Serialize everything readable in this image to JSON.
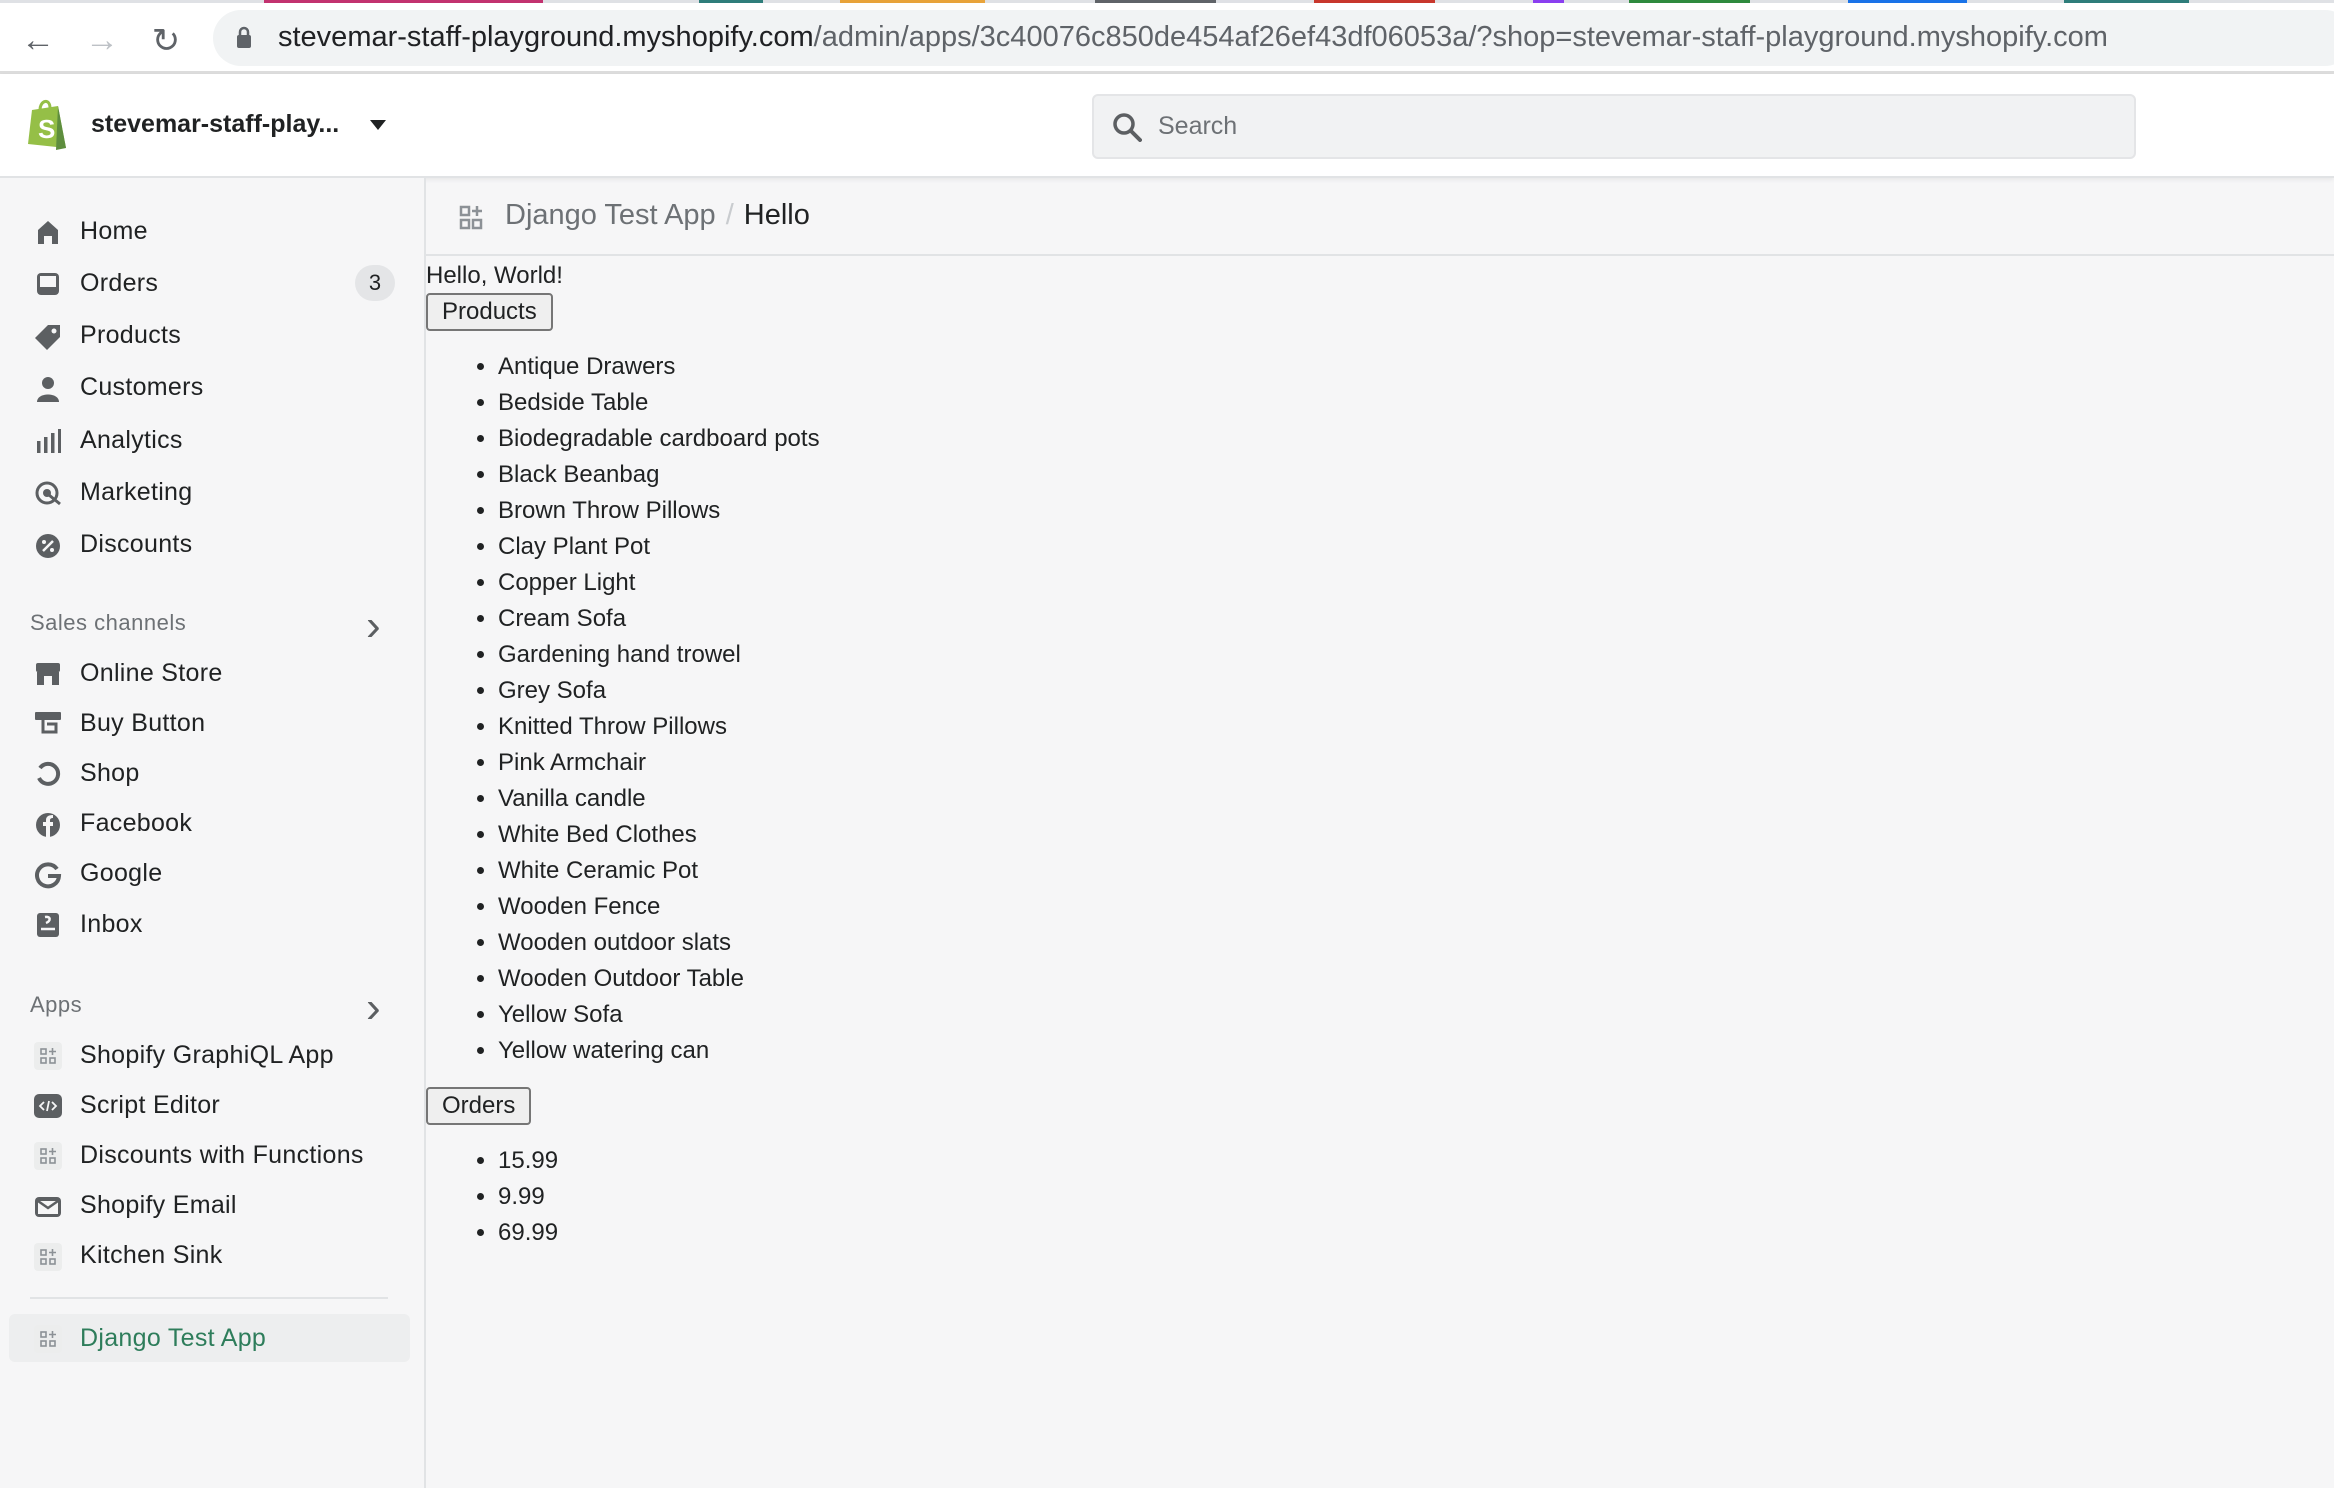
{
  "browser": {
    "url_host": "stevemar-staff-playground.myshopify.com",
    "url_path": "/admin/apps/3c40076c850de454af26ef43df06053a/?shop=stevemar-staff-playground.myshopify.com",
    "tab_colors": [
      "#c2326f",
      "#2e7d7a",
      "#e8a33a",
      "#5f6368",
      "#c8372d",
      "#8a3ff0",
      "#2f8a3e",
      "#1a73e8",
      "#2e7d7a"
    ]
  },
  "header": {
    "store_name": "stevemar-staff-play...",
    "search_placeholder": "Search"
  },
  "sidebar": {
    "main": [
      {
        "label": "Home",
        "icon": "home-icon"
      },
      {
        "label": "Orders",
        "icon": "orders-icon",
        "badge": "3"
      },
      {
        "label": "Products",
        "icon": "tag-icon"
      },
      {
        "label": "Customers",
        "icon": "person-icon"
      },
      {
        "label": "Analytics",
        "icon": "bar-chart-icon"
      },
      {
        "label": "Marketing",
        "icon": "target-icon"
      },
      {
        "label": "Discounts",
        "icon": "discount-icon"
      }
    ],
    "sales_channels_label": "Sales channels",
    "sales_channels": [
      {
        "label": "Online Store",
        "icon": "store-icon"
      },
      {
        "label": "Buy Button",
        "icon": "buy-button-icon"
      },
      {
        "label": "Shop",
        "icon": "shop-icon"
      },
      {
        "label": "Facebook",
        "icon": "facebook-icon"
      },
      {
        "label": "Google",
        "icon": "google-icon"
      },
      {
        "label": "Inbox",
        "icon": "inbox-icon"
      }
    ],
    "apps_label": "Apps",
    "apps": [
      {
        "label": "Shopify GraphiQL App",
        "icon": "app-icon"
      },
      {
        "label": "Script Editor",
        "icon": "code-icon"
      },
      {
        "label": "Discounts with Functions",
        "icon": "app-icon"
      },
      {
        "label": "Shopify Email",
        "icon": "email-icon"
      },
      {
        "label": "Kitchen Sink",
        "icon": "app-icon"
      }
    ],
    "active_app": {
      "label": "Django Test App",
      "icon": "app-icon"
    },
    "accent": "#2e7d5b"
  },
  "breadcrumb": {
    "app": "Django Test App",
    "separator": "/",
    "current": "Hello"
  },
  "main": {
    "greeting": "Hello, World!",
    "products_button": "Products",
    "products": [
      "Antique Drawers",
      "Bedside Table",
      "Biodegradable cardboard pots",
      "Black Beanbag",
      "Brown Throw Pillows",
      "Clay Plant Pot",
      "Copper Light",
      "Cream Sofa",
      "Gardening hand trowel",
      "Grey Sofa",
      "Knitted Throw Pillows",
      "Pink Armchair",
      "Vanilla candle",
      "White Bed Clothes",
      "White Ceramic Pot",
      "Wooden Fence",
      "Wooden outdoor slats",
      "Wooden Outdoor Table",
      "Yellow Sofa",
      "Yellow watering can"
    ],
    "orders_button": "Orders",
    "orders": [
      "15.99",
      "9.99",
      "69.99"
    ]
  }
}
